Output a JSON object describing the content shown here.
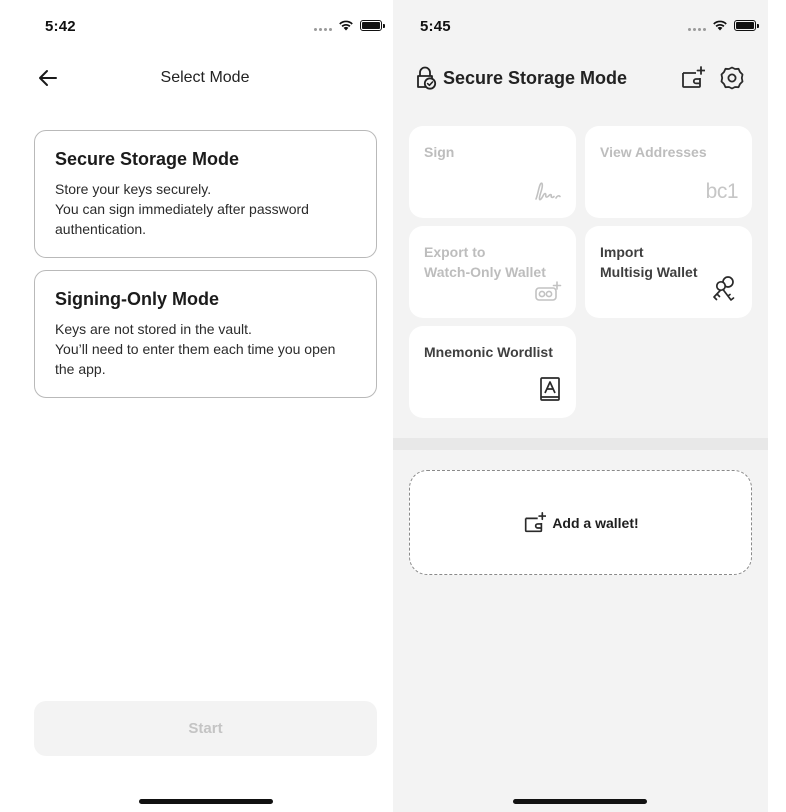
{
  "left_screen": {
    "status_bar": {
      "time": "5:42"
    },
    "nav": {
      "title": "Select Mode"
    },
    "modes": [
      {
        "title": "Secure Storage Mode",
        "description": "Store your keys securely.\nYou can sign immediately after password authentication."
      },
      {
        "title": "Signing-Only Mode",
        "description": "Keys are not stored in the vault.\nYou’ll need to enter them each time you open the app."
      }
    ],
    "start_button": {
      "label": "Start",
      "enabled": false
    }
  },
  "right_screen": {
    "status_bar": {
      "time": "5:45"
    },
    "header": {
      "title": "Secure Storage Mode",
      "icon": "lock-check-icon"
    },
    "tiles": [
      {
        "label": "Sign",
        "icon": "signature-icon",
        "enabled": false
      },
      {
        "label": "View Addresses",
        "icon_text": "bc1",
        "enabled": false
      },
      {
        "label": "Export to\nWatch-Only Wallet",
        "icon": "glasses-plus-icon",
        "enabled": false
      },
      {
        "label": "Import\nMultisig Wallet",
        "icon": "keys-icon",
        "enabled": true
      },
      {
        "label": "Mnemonic Wordlist",
        "icon": "book-a-icon",
        "enabled": true
      }
    ],
    "add_wallet": {
      "label": "Add a wallet!"
    }
  },
  "colors": {
    "disabled_text": "#bdbdbd",
    "card_border": "#b9b9b9",
    "right_background": "#f3f3f3"
  }
}
